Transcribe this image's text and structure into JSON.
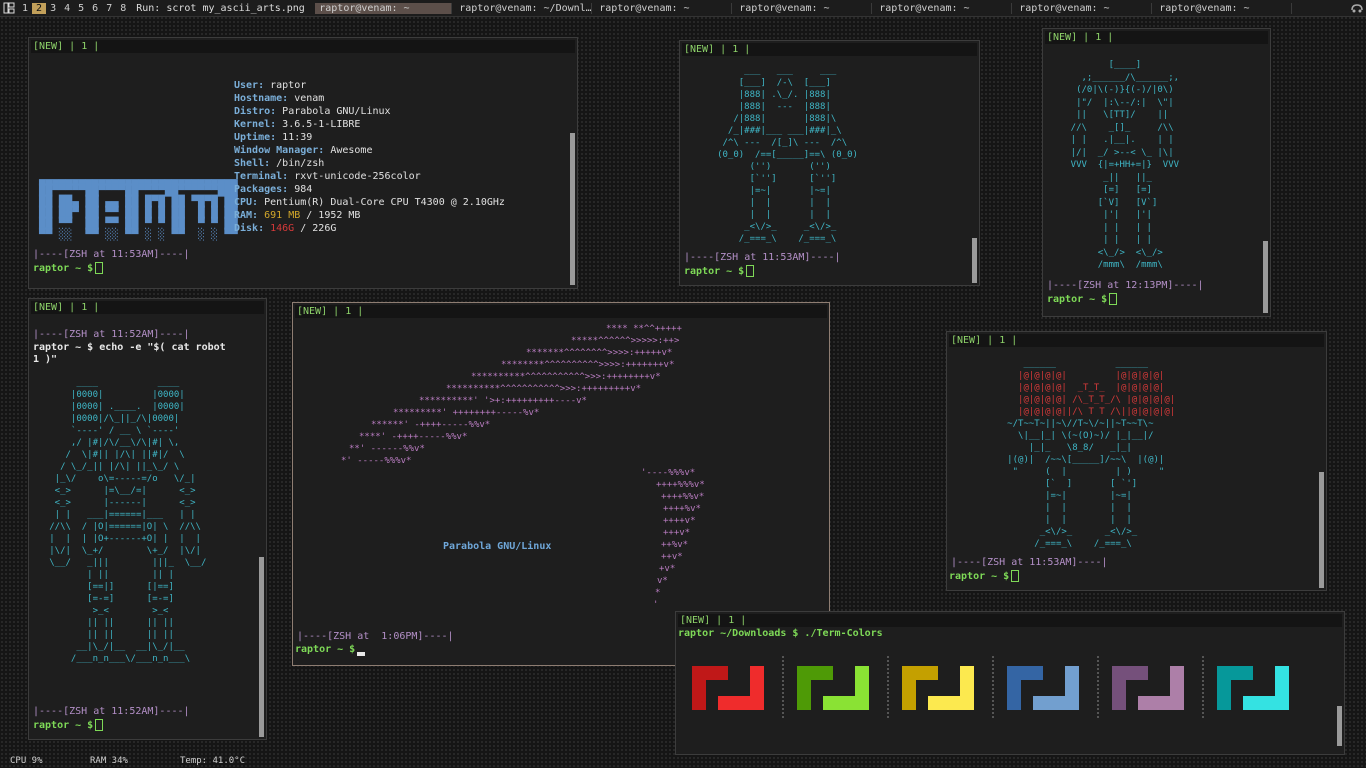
{
  "topbar": {
    "tags": [
      "1",
      "2",
      "3",
      "4",
      "5",
      "6",
      "7",
      "8"
    ],
    "active_tag": "2",
    "prompt": "Run: scrot my_ascii_arts.png",
    "tasks": [
      "raptor@venam: ~",
      "raptor@venam: ~/Downl…",
      "raptor@venam: ~",
      "raptor@venam: ~",
      "raptor@venam: ~",
      "raptor@venam: ~",
      "raptor@venam: ~"
    ]
  },
  "tab": {
    "new": "[NEW]",
    "sep": "|",
    "num": "1"
  },
  "sysinfo": {
    "rows": [
      {
        "k": "User:",
        "v": "raptor"
      },
      {
        "k": "Hostname:",
        "v": "venam"
      },
      {
        "k": "Distro:",
        "v": "Parabola GNU/Linux"
      },
      {
        "k": "Kernel:",
        "v": "3.6.5-1-LIBRE"
      },
      {
        "k": "Uptime:",
        "v": "11:39"
      },
      {
        "k": "Window Manager:",
        "v": "Awesome"
      },
      {
        "k": "Shell:",
        "v": "/bin/zsh"
      },
      {
        "k": "Terminal:",
        "v": "rxvt-unicode-256color"
      },
      {
        "k": "Packages:",
        "v": "984"
      },
      {
        "k": "CPU:",
        "v": "Pentium(R) Dual-Core CPU T4300 @ 2.10GHz"
      }
    ],
    "ram_label": "RAM:",
    "ram_used": "691 MB",
    "ram_total": " / 1952 MB",
    "disk_label": "Disk:",
    "disk_used": "146G",
    "disk_total": " / 226G",
    "logo_rows": [
      "▄▄▄▄▄▄▄▄▄▄▄▄▄▄▄▄▄▄▄▄▄▄▄▄▄▄▄▄▄▄",
      "██▀▀▀▀▀██▀▀▀▀██▀▀▀▀██▀▀▀▀▀▀███",
      "██ ██▄ ██ ▄▄ ██ █▀█ ██ ▀█▀█ ██",
      "██ ██▀ ██ ▀▀ ██ █ █ ██  █ █ ██",
      "██ ▀▀  ██ ▀▀ ██ ▀ ▀ ██  ▀ ▀ ██",
      "▀▀ ░░  ▀▀ ░░ ▀▀ ░ ░ ▀▀  ░ ░ ▀▀"
    ]
  },
  "prompts": {
    "t1_sep": "|----[ZSH at 11:53AM]----|",
    "t2_sep": "|----[ZSH at 11:53AM]----|",
    "t3_sep": "|----[ZSH at 12:13PM]----|",
    "t4_sep1": "|----[ZSH at 11:52AM]----|",
    "t4_cmd": "raptor ~ $ echo -e \"$( cat robot",
    "t4_cmd2": "1 )\"",
    "t4_sep2": "|----[ZSH at 11:52AM]----|",
    "t5_sep": "|----[ZSH at  1:06PM]----|",
    "t6_sep": "|----[ZSH at 11:53AM]----|",
    "ps1": "raptor ~ $",
    "t7_cmd": "raptor ~/Downloads $ ./Term-Colors"
  },
  "parabola_label": "Parabola GNU/Linux",
  "robot2": [
    "          ___   ___     ___",
    "         [___]  /-\\  [___]",
    "         |888| .\\_/. |888|",
    "         |888|  ---  |888|",
    "        /|888|       |888|\\",
    "       /_|###|___ ___|###|_\\",
    "      /^\\ ---  /[_]\\ ---  /^\\",
    "     (0_0)  /==[_____]==\\ (0_0)",
    "           ('')       ('')",
    "           [`'']      [`'']",
    "           |=~|       |~=|",
    "           |  |       |  |",
    "           |  |       |  |",
    "          _<\\/>_     _<\\/>_",
    "         /_===_\\    /_===_\\"
  ],
  "robot3": [
    "           [____]",
    "      ,;______/\\______;,",
    "     (/0|\\(-)}{(-)/|0\\)",
    "     |\"/  |:\\--/:|  \\\"|",
    "     ||   \\[TT]/    ||",
    "    //\\    _[]_     /\\\\",
    "    | |   .|__|.    | |",
    "    |/|  _/ >--< \\_ |\\|",
    "    VVV  {|=+HH+=|}  VVV",
    "          _||   ||_",
    "          [=]   [=]",
    "         [`V]   [V`]",
    "          |'|   |'|",
    "          | |   | |",
    "          | |   | |",
    "         <\\_/>  <\\_/>",
    "         /mmm\\  /mmm\\"
  ],
  "robot4": [
    "        ____           ____",
    "       |0000|         |0000|",
    "       |0000| .____.  |0000|",
    "       |0000|/\\_||_/\\|0000|",
    "       `----' / __ \\ `----'",
    "       ,/ |#|/\\/__\\/\\|#| \\,",
    "      /  \\|#|| |/\\| ||#|/  \\",
    "     / \\_/_|| |/\\| ||_\\_/ \\",
    "    |_\\/    o\\=-----=/o   \\/_|",
    "    <_>      |=\\__/=|      <_>",
    "    <_>      |------|      <_>",
    "    | |   ___|======|___   | |",
    "   //\\\\  / |O|======|O| \\  //\\\\",
    "   |  |  | |O+------+O| |  |  |",
    "   |\\/|  \\_+/        \\+_/  |\\/|",
    "   \\__/   _|||        |||_  \\__/",
    "          | ||        || |",
    "          [==|]      [|==]",
    "          [=-=]      [=-=]",
    "           >_<        >_<",
    "          || ||      || ||",
    "          || ||      || ||",
    "        __|\\_/|__  __|\\_/|__",
    "       /___n_n___\\/___n_n___\\"
  ],
  "robot6": [
    "             ______           ______",
    "            |@|@|@|@|         |@|@|@|@|",
    "            |@|@|@|@|  _T_T_  |@|@|@|@|",
    "            |@|@|@|@| /\\_T_T_/\\ |@|@|@|@|",
    "            |@|@|@|@||/\\ T T /\\||@|@|@|@|",
    "          ~/T~~T~||~\\//T~\\/~||~T~~T\\~",
    "            \\|__|_| \\(~(O)~)/ |_|__|/",
    "              |_|_   \\8_8/   _|_|",
    "          |(@)|  /~~\\[_____]/~~\\  |(@)|",
    "           \"     (  |         | )     \"",
    "                 [`  ]       [ `']",
    "                 |=~|        |~=|",
    "                 |  |        |  |",
    "                 |  |        |  |",
    "                _<\\/>_      _<\\/>_",
    "               /_===_\\    /_===_\\"
  ],
  "colors": [
    {
      "dark": "#c01818",
      "light": "#ef2c2c"
    },
    {
      "dark": "#4e9a06",
      "light": "#8ae234"
    },
    {
      "dark": "#c4a000",
      "light": "#fce94f"
    },
    {
      "dark": "#3465a4",
      "light": "#729fcf"
    },
    {
      "dark": "#75507b",
      "light": "#ad7fa8"
    },
    {
      "dark": "#06989a",
      "light": "#34e2e2"
    }
  ],
  "status": {
    "cpu": "CPU 9%",
    "ram": "RAM 34%",
    "temp": "Temp: 41.0°C"
  }
}
